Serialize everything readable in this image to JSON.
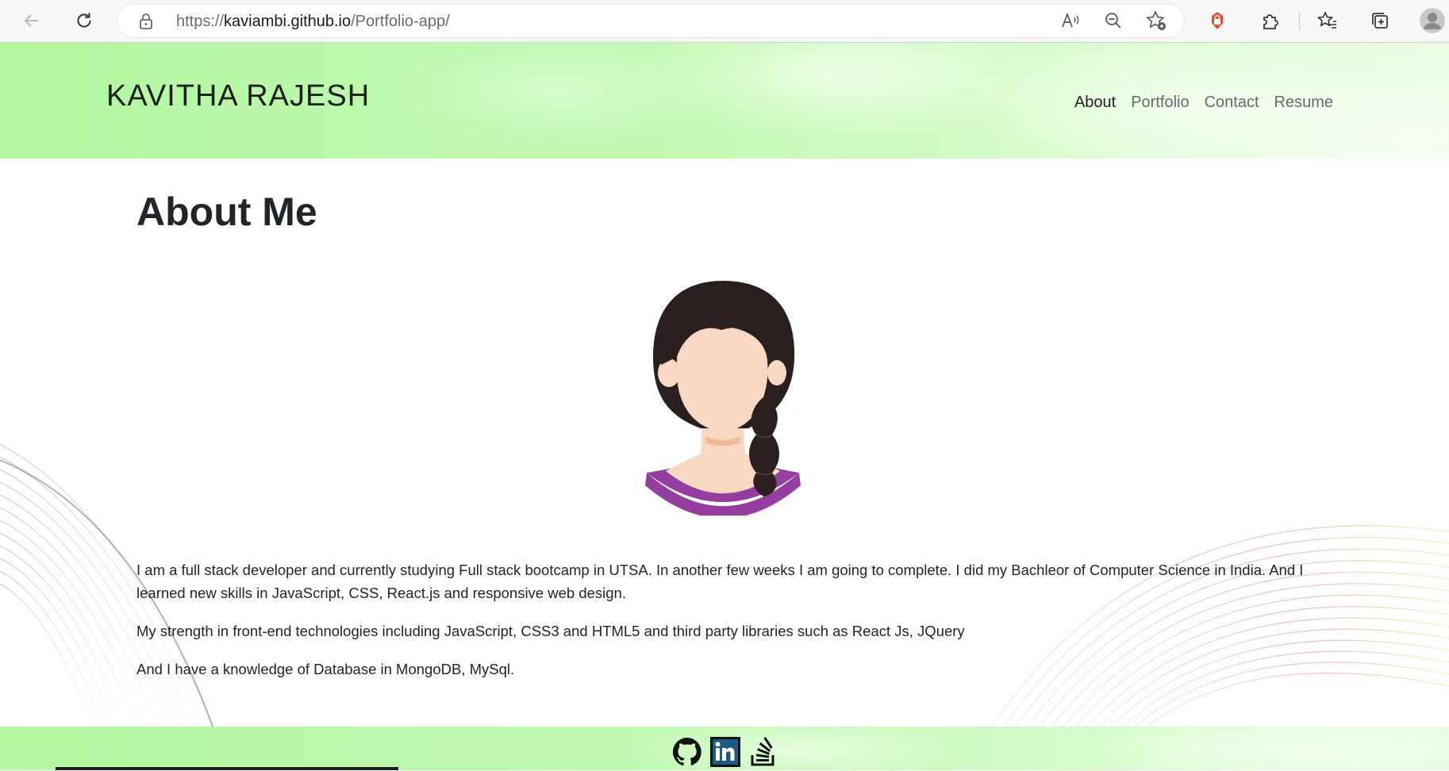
{
  "browser": {
    "url_prefix": "https://",
    "url_host": "kaviambi.github.io",
    "url_path": "/Portfolio-app/",
    "icons": [
      "back-arrow-icon",
      "refresh-icon",
      "lock-icon",
      "read-aloud-icon",
      "zoom-out-icon",
      "add-favorite-icon",
      "extension-red-icon",
      "extensions-icon",
      "favorites-icon",
      "collections-icon",
      "profile-avatar-icon"
    ]
  },
  "header": {
    "brand": "KAVITHA RAJESH",
    "nav": [
      {
        "label": "About",
        "active": true
      },
      {
        "label": "Portfolio",
        "active": false
      },
      {
        "label": "Contact",
        "active": false
      },
      {
        "label": "Resume",
        "active": false
      }
    ]
  },
  "about": {
    "title": "About Me",
    "avatar_icon": "female-avatar-illustration",
    "paragraphs": [
      "I am a full stack developer and currently studying Full stack bootcamp in UTSA. In another few weeks I am going to complete. I did my Bachleor of Computer Science in India. And I learned new skills in JavaScript, CSS, React.js and responsive web design.",
      "My strength in front-end technologies including JavaScript, CSS3 and HTML5 and third party libraries such as React Js, JQuery",
      "And I have a knowledge of Database in MongoDB, MySql."
    ]
  },
  "footer": {
    "social_icons": [
      "github-icon",
      "linkedin-icon",
      "stackoverflow-icon"
    ]
  },
  "colors": {
    "header_green": "#b2f7a1",
    "text_dark": "#212529",
    "nav_muted": "#6a6a6a",
    "avatar_shirt": "#943ea0",
    "avatar_hair": "#2a1f1f",
    "avatar_skin": "#f8d8c3",
    "linkedin_blue": "#1a5a87"
  }
}
